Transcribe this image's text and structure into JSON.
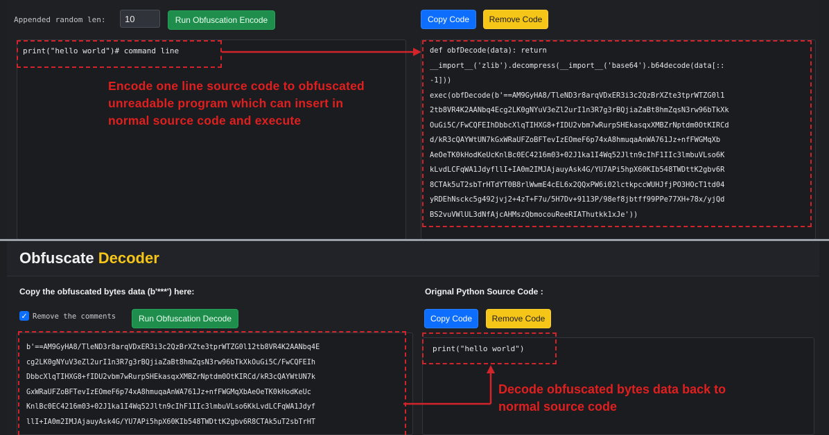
{
  "encoder": {
    "random_len_label": "Appended random len:",
    "random_len_value": "10",
    "run_button": "Run Obfuscation Encode",
    "copy_button": "Copy Code",
    "remove_button": "Remove Code",
    "input_code": "print(\"hello world\")# command line",
    "annotation": [
      "Encode one line source code to obfuscated",
      "unreadable program which can insert in",
      "normal source code and execute"
    ],
    "output_lines": [
      "def obfDecode(data): return",
      "__import__('zlib').decompress(__import__('base64').b64decode(data[::",
      "-1]))",
      "exec(obfDecode(b'==AM9GyHA8/TleND3r8arqVDxER3i3c2QzBrXZte3tprWTZG0l1",
      "2tb8VR4K2AANbq4Ecg2LK0gNYuV3eZl2urI1n3R7g3rBQjiaZaBt8hmZqsN3rw96bTkXk",
      "OuGi5C/FwCQFEIhDbbcXlqTIHXG8+fIDU2vbm7wRurpSHEkasqxXMBZrNptdm0OtKIRCd",
      "d/kR3cQAYWtUN7kGxWRaUFZoBFTevIzEOmeF6p74xA8hmuqaAnWA761Jz+nfFWGMqXb",
      "AeOeTK0kHodKeUcKnlBc0EC4216m03+02J1ka1I4Wq52Jltn9cIhF1IIc3lmbuVLso6K",
      "kLvdLCFqWA1JdyfllI+IA0m2IMJAjauyAsk4G/YU7APi5hpX60KIb548TWDttK2gbv6R",
      "8CTAk5uT2sbTrHTdYT0B8rlWwmE4cEL6x2QQxPW6i02lctkpccWUHJfjPO3HOcT1td04",
      "yRDEhNsckc5g492jvj2+4zT+F7u/5H7Dv+9113P/98ef8jbtff99PPe77XH+78x/yjQd",
      "BS2vuVWlUL3dNfAjcAHMszQbmocouReeRIAThutkk1xJe'))"
    ]
  },
  "decoder": {
    "title_part1": "Obfuscate",
    "title_part2": "Decoder",
    "copy_label": "Copy the obfuscated bytes data (b'***') here:",
    "remove_comments_label": "Remove the comments",
    "remove_comments_checked": true,
    "run_button": "Run Obfuscation Decode",
    "source_label": "Orignal Python Source Code :",
    "copy_button": "Copy Code",
    "remove_button": "Remove Code",
    "input_lines": [
      "b'==AM9GyHA8/TleND3r8arqVDxER3i3c2QzBrXZte3tprWTZG0l12tb8VR4K2AANbq4E",
      "cg2LK0gNYuV3eZl2urI1n3R7g3rBQjiaZaBt8hmZqsN3rw96bTkXkOuGi5C/FwCQFEIh",
      "DbbcXlqTIHXG8+fIDU2vbm7wRurpSHEkasqxXMBZrNptdm0OtKIRCd/kR3cQAYWtUN7k",
      "GxWRaUFZoBFTevIzEOmeF6p74xA8hmuqaAnWA761Jz+nfFWGMqXbAeOeTK0kHodKeUc",
      "KnlBc0EC4216m03+02J1ka1I4Wq52Jltn9cIhF1IIc3lmbuVLso6KkLvdLCFqWA1Jdyf",
      "llI+IA0m2IMJAjauyAsk4G/YU7APi5hpX60KIb548TWDttK2gbv6R8CTAk5uT2sbTrHT"
    ],
    "output_code": "print(\"hello world\")",
    "annotation": [
      "Decode obfuscated bytes data back to",
      "normal source code"
    ]
  },
  "colors": {
    "accent_yellow": "#f5c518",
    "annotation_red": "#d4242b",
    "run_green": "#1f8e4c",
    "copy_blue": "#0d6efd"
  }
}
